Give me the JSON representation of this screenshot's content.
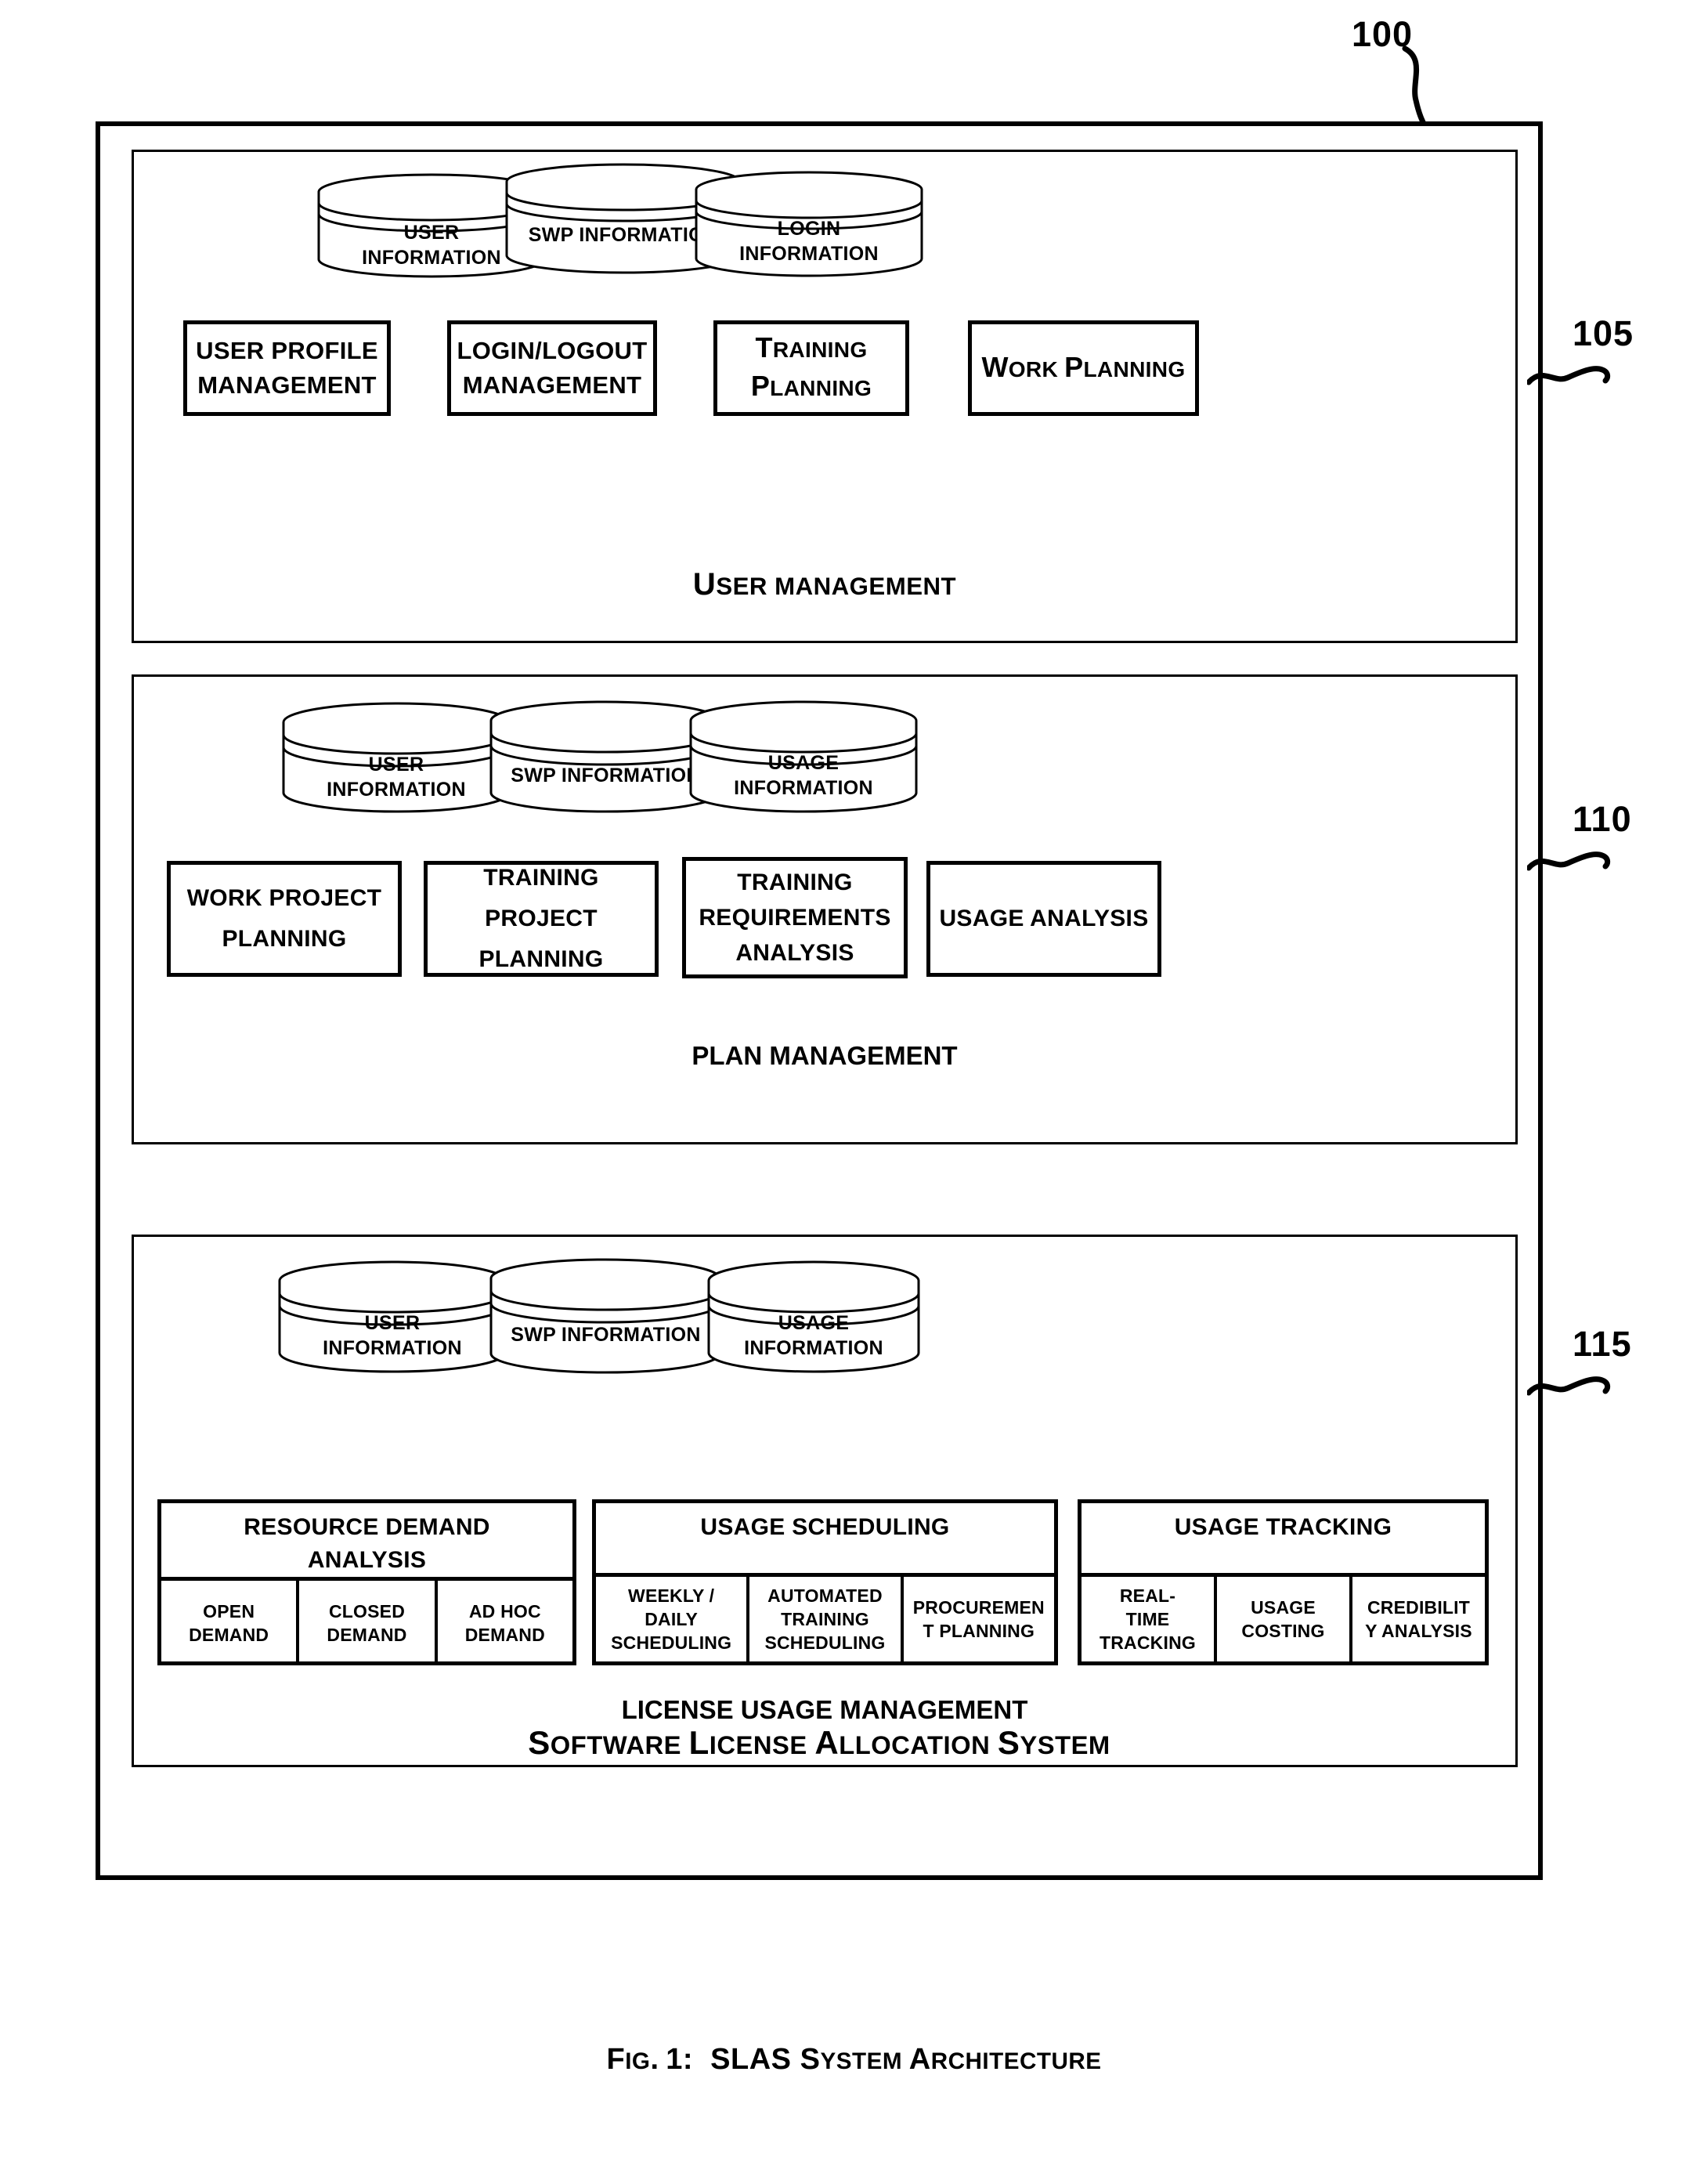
{
  "figure": {
    "number_label": "100",
    "caption_prefix": "Fig. 1:",
    "caption_title": "SLAS System Architecture",
    "caption_full": "Fig. 1:  SLAS System Architecture",
    "system_title": "Software License Allocation System"
  },
  "reference_numerals": {
    "system": "100",
    "user_management": "105",
    "plan_management": "110",
    "license_usage_management": "115"
  },
  "sections": [
    {
      "ref": "105",
      "title": "User Management",
      "title_cap": "U",
      "title_rest": "SER MANAGEMENT",
      "datastores": [
        {
          "line1": "USER",
          "line2": "INFORMATION"
        },
        {
          "line1": "SWP  INFORMATION",
          "line2": ""
        },
        {
          "line1": "LOGIN",
          "line2": "INFORMATION"
        }
      ],
      "modules": [
        {
          "line1": "USER PROFILE",
          "line2": "MANAGEMENT",
          "style": "plain"
        },
        {
          "line1": "LOGIN/LOGOUT",
          "line2": "MANAGEMENT",
          "style": "plain"
        },
        {
          "line1": "Training",
          "line2": "Planning",
          "style": "smallcaps",
          "c1": "T",
          "r1": "RAINING",
          "c2": "P",
          "r2": "LANNING"
        },
        {
          "line1": "Work Planning",
          "line2": "",
          "style": "smallcaps",
          "c1": "W",
          "r1": "ORK ",
          "c2": "P",
          "r2": "LANNING"
        }
      ]
    },
    {
      "ref": "110",
      "title": "PLAN MANAGEMENT",
      "datastores": [
        {
          "line1": "USER",
          "line2": "INFORMATION"
        },
        {
          "line1": "SWP INFORMATION",
          "line2": ""
        },
        {
          "line1": "USAGE",
          "line2": "INFORMATION"
        }
      ],
      "modules": [
        {
          "line1": "WORK PROJECT",
          "line2": "PLANNING",
          "line3": ""
        },
        {
          "line1": "TRAINING PROJECT",
          "line2": "PLANNING",
          "line3": ""
        },
        {
          "line1": "TRAINING",
          "line2": "REQUIREMENTS",
          "line3": "ANALYSIS"
        },
        {
          "line1": "USAGE ANALYSIS",
          "line2": "",
          "line3": ""
        }
      ]
    },
    {
      "ref": "115",
      "title": "LICENSE USAGE MANAGEMENT",
      "datastores": [
        {
          "line1": "USER",
          "line2": "INFORMATION"
        },
        {
          "line1": "SWP INFORMATION",
          "line2": ""
        },
        {
          "line1": "USAGE",
          "line2": "INFORMATION"
        }
      ],
      "groups": [
        {
          "header_line1": "RESOURCE DEMAND",
          "header_line2": "ANALYSIS",
          "cells": [
            {
              "line1": "OPEN",
              "line2": "DEMAND",
              "line3": ""
            },
            {
              "line1": "CLOSED",
              "line2": "DEMAND",
              "line3": ""
            },
            {
              "line1": "AD HOC",
              "line2": "DEMAND",
              "line3": ""
            }
          ]
        },
        {
          "header_line1": "USAGE SCHEDULING",
          "header_line2": "",
          "cells": [
            {
              "line1": "WEEKLY /",
              "line2": "DAILY",
              "line3": "SCHEDULING"
            },
            {
              "line1": "AUTOMATED",
              "line2": "TRAINING",
              "line3": "SCHEDULING"
            },
            {
              "line1": "PROCUREMEN",
              "line2": "T PLANNING",
              "line3": ""
            }
          ]
        },
        {
          "header_line1": "USAGE TRACKING",
          "header_line2": "",
          "cells": [
            {
              "line1": "REAL-",
              "line2": "TIME",
              "line3": "TRACKING"
            },
            {
              "line1": "USAGE",
              "line2": "COSTING",
              "line3": ""
            },
            {
              "line1": "CREDIBILIT",
              "line2": "Y ANALYSIS",
              "line3": ""
            }
          ]
        }
      ]
    }
  ],
  "colors": {
    "ink": "#000000",
    "paper": "#ffffff"
  }
}
